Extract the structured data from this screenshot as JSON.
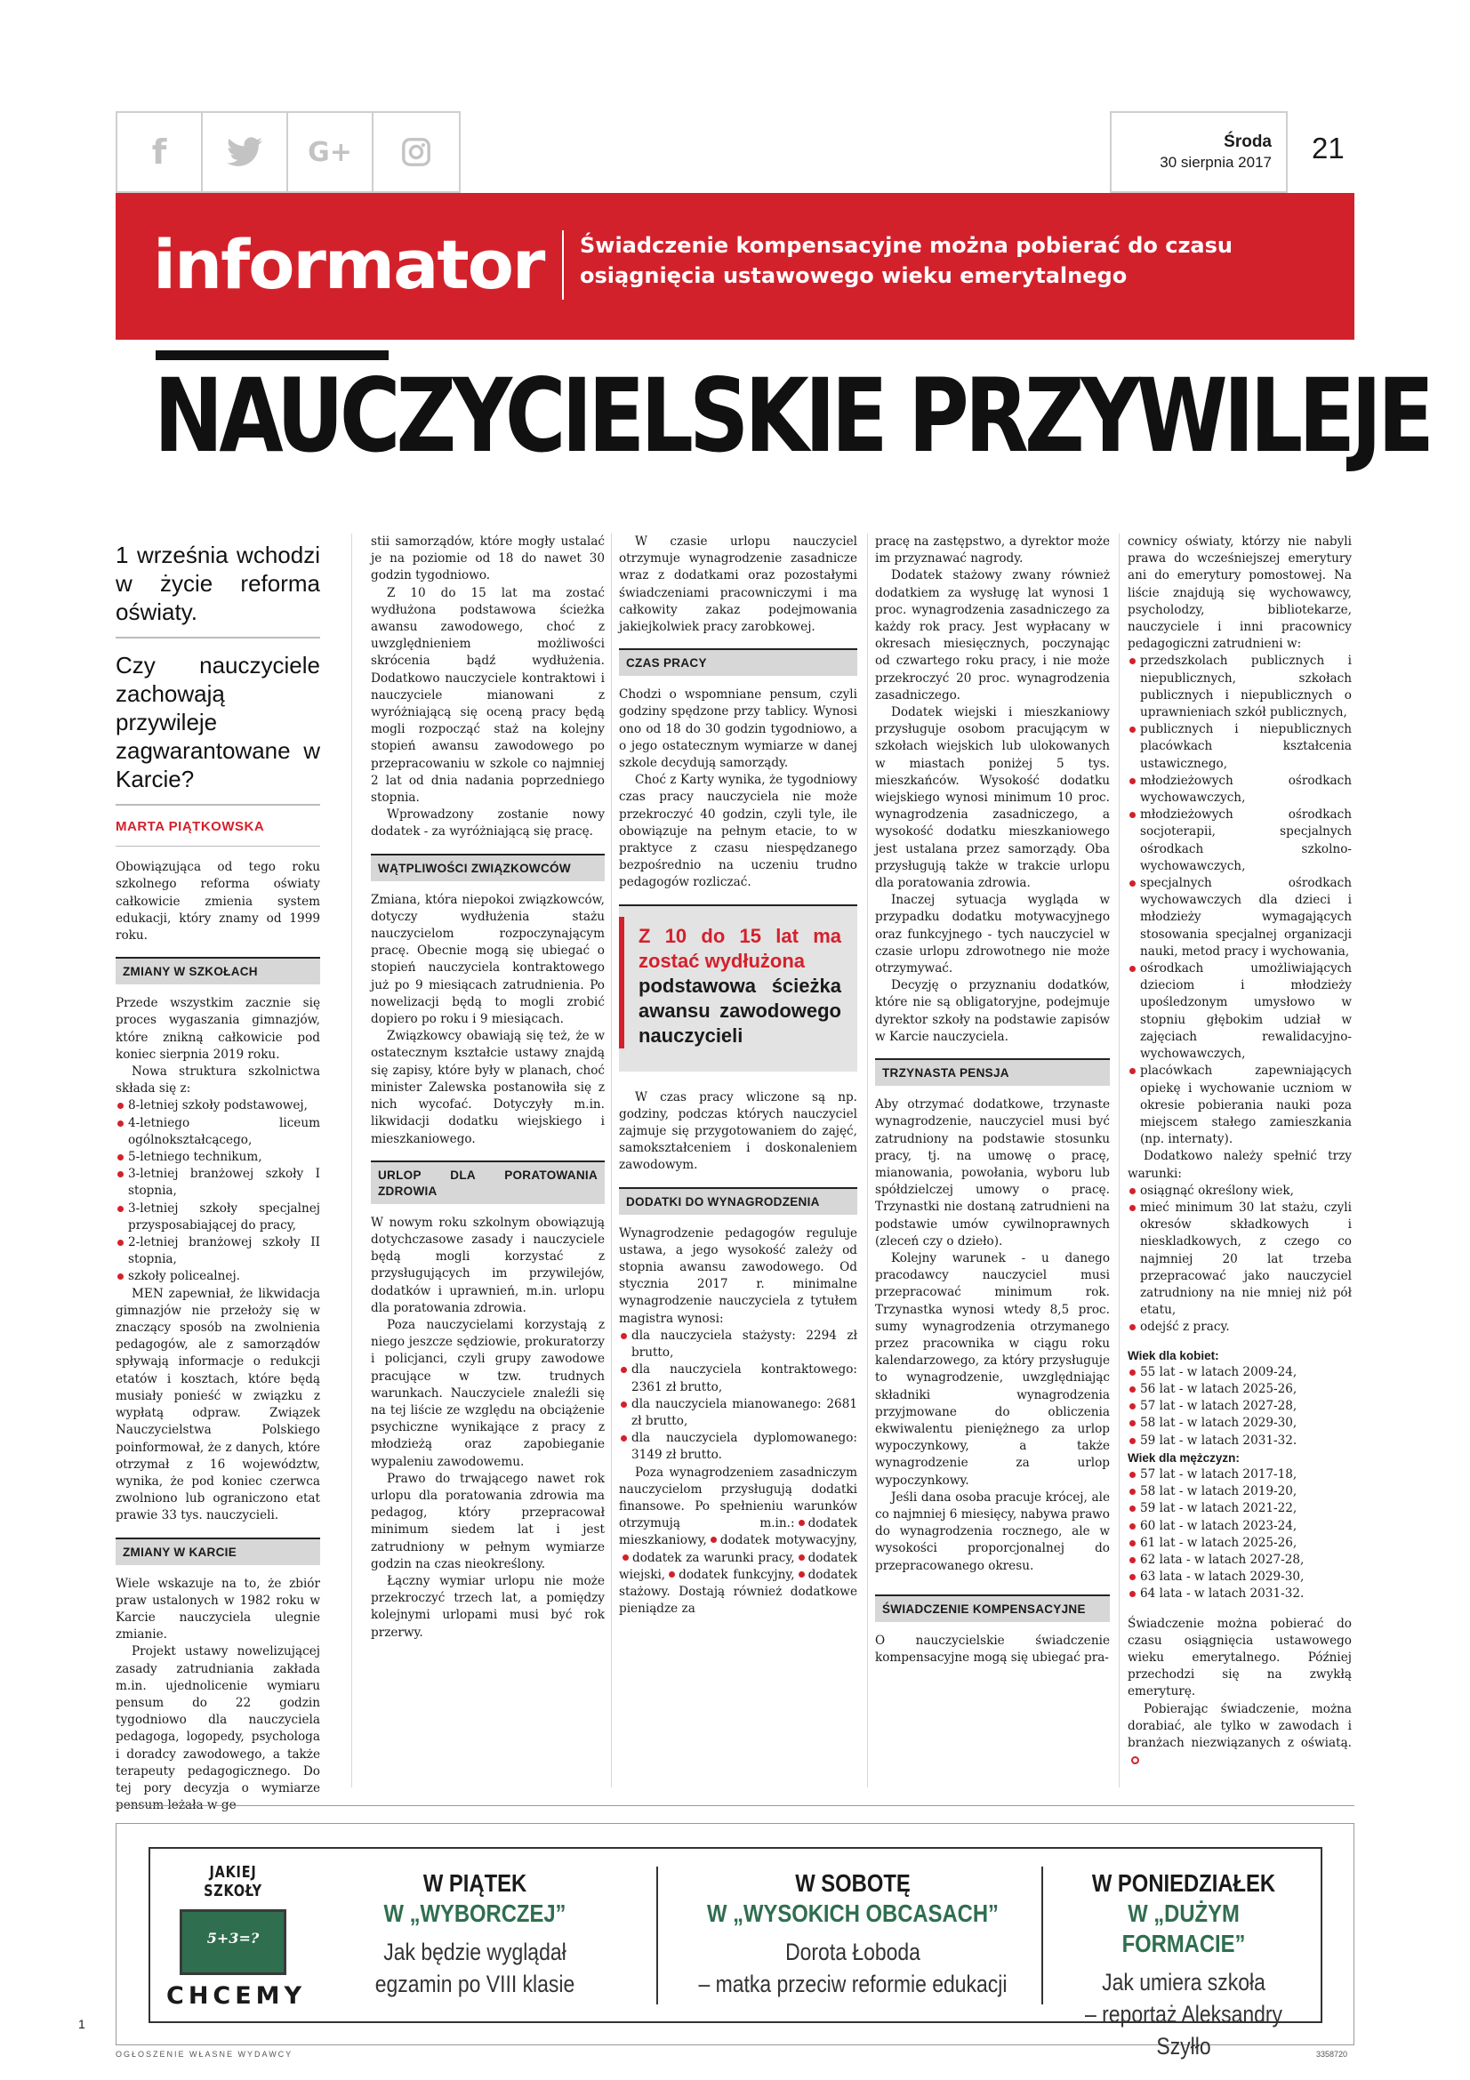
{
  "social": {
    "facebook": "f",
    "twitter": "🐦",
    "gplus": "G+",
    "instagram": "◎"
  },
  "header": {
    "day": "Środa",
    "date": "30 sierpnia 2017",
    "page": "21"
  },
  "banner": {
    "brand": "informator",
    "tagline": "Świadczenie kompensacyjne można pobierać do czasu osiągnięcia ustawowego wieku emerytalnego"
  },
  "headline": "NAUCZYCIELSKIE PRZYWILEJE",
  "lead": {
    "q1": "1 września wchodzi w życie reforma oświaty.",
    "q2": "Czy nauczyciele zachowają przywileje zagwarantowane w Karcie?",
    "author": "MARTA PIĄTKOWSKA"
  },
  "col1": {
    "intro": "Obowiązująca od tego roku szkolnego reforma oświaty całkowicie zmienia system edukacji, który znamy od 1999 roku.",
    "s1": "ZMIANY W SZKOŁACH",
    "p1": "Przede wszystkim zacznie się proces wygaszania gimnazjów, które znikną całkowicie pod koniec sierpnia 2019 roku.",
    "p2": "Nowa struktura szkolnictwa składa się z:",
    "list": [
      "8-letniej szkoły podstawowej,",
      "4-letniego liceum ogólnokształcącego,",
      "5-letniego technikum,",
      "3-letniej branżowej szkoły I stopnia,",
      "3-letniej szkoły specjalnej przysposabiającej do pracy,",
      "2-letniej branżowej szkoły II stopnia,",
      "szkoły policealnej."
    ],
    "p3": "MEN zapewniał, że likwidacja gimnazjów nie przełoży się w znaczący sposób na zwolnienia pedagogów, ale z samorządów spływają informacje o redukcji etatów i kosztach, które będą musiały ponieść w związku z wypłatą odpraw. Związek Nauczycielstwa Polskiego poinformował, że z danych, które otrzymał z 16 województw, wynika, że pod koniec czerwca zwolniono lub ograniczono etat prawie 33 tys. nauczycieli.",
    "s2": "ZMIANY W KARCIE",
    "p4": "Wiele wskazuje na to, że zbiór praw ustalonych w 1982 roku w Karcie nauczyciela ulegnie zmianie.",
    "p5": "Projekt ustawy nowelizującej zasady zatrudniania zakłada m.in. ujednolicenie wymiaru pensum do 22 godzin tygodniowo dla nauczyciela pedagoga, logopedy, psychologa i doradcy zawodowego, a także terapeuty pedagogicznego. Do tej pory decyzja o wymiarze pensum leżała w ge-"
  },
  "col2": {
    "p1": "stii samorządów, które mogły ustalać je na poziomie od 18 do nawet 30 godzin tygodniowo.",
    "p2": "Z 10 do 15 lat ma zostać wydłużona podstawowa ścieżka awansu zawodowego, choć z uwzględnieniem możliwości skrócenia bądź wydłużenia. Dodatkowo nauczyciele kontraktowi i nauczyciele mianowani z wyróżniającą się oceną pracy będą mogli rozpocząć staż na kolejny stopień awansu zawodowego po przepracowaniu w szkole co najmniej 2 lat od dnia nadania poprzedniego stopnia.",
    "p3": "Wprowadzony zostanie nowy dodatek - za wyróżniającą się pracę.",
    "s1": "WĄTPLIWOŚCI ZWIĄZKOWCÓW",
    "p4": "Zmiana, która niepokoi związkowców, dotyczy wydłużenia stażu nauczycielom rozpoczynającym pracę. Obecnie mogą się ubiegać o stopień nauczyciela kontraktowego już po 9 miesiącach zatrudnienia. Po nowelizacji będą to mogli zrobić dopiero po roku i 9 miesiącach.",
    "p5": "Związkowcy obawiają się też, że w ostatecznym kształcie ustawy znajdą się zapisy, które były w planach, choć minister Zalewska postanowiła się z nich wycofać. Dotyczyły m.in. likwidacji dodatku wiejskiego i mieszkaniowego.",
    "s2": "URLOP DLA PORATOWANIA ZDROWIA",
    "p6": "W nowym roku szkolnym obowiązują dotychczasowe zasady i nauczyciele będą mogli korzystać z przysługujących im przywilejów, dodatków i uprawnień, m.in. urlopu dla poratowania zdrowia.",
    "p7": "Poza nauczycielami korzystają z niego jeszcze sędziowie, prokuratorzy i policjanci, czyli grupy zawodowe pracujące w tzw. trudnych warunkach. Nauczyciele znaleźli się na tej liście ze względu na obciążenie psychiczne wynikające z pracy z młodzieżą oraz zapobieganie wypaleniu zawodowemu.",
    "p8": "Prawo do trwającego nawet rok urlopu dla poratowania zdrowia ma pedagog, który przepracował minimum siedem lat i jest zatrudniony w pełnym wymiarze godzin na czas nieokreślony.",
    "p9": "Łączny wymiar urlopu nie może przekroczyć trzech lat, a pomiędzy kolejnymi urlopami musi być rok przerwy."
  },
  "col3": {
    "p1": "W czasie urlopu nauczyciel otrzymuje wynagrodzenie zasadnicze wraz z dodatkami oraz pozostałymi świadczeniami pracowniczymi i ma całkowity zakaz podejmowania jakiejkolwiek pracy zarobkowej.",
    "s1": "CZAS PRACY",
    "p2": "Chodzi o wspomniane pensum, czyli godziny spędzone przy tablicy. Wynosi ono od 18 do 30 godzin tygodniowo, a o jego ostatecznym wymiarze w danej szkole decydują samorządy.",
    "p3": "Choć z Karty wynika, że tygodniowy czas pracy nauczyciela nie może przekroczyć 40 godzin, czyli tyle, ile obowiązuje na pełnym etacie, to w praktyce z czasu niespędzanego bezpośrednio na uczeniu trudno pedagogów rozliczać.",
    "pull_red": "Z 10 do 15 lat ma zostać wydłużona",
    "pull_black": "podstawowa ścieżka awansu zawodowego nauczycieli",
    "p4": "W czas pracy wliczone są np. godziny, podczas których nauczyciel zajmuje się przygotowaniem do zajęć, samokształceniem i doskonaleniem zawodowym.",
    "s2": "DODATKI DO WYNAGRODZENIA",
    "p5": "Wynagrodzenie pedagogów reguluje ustawa, a jego wysokość zależy od stopnia awansu zawodowego. Od stycznia 2017 r. minimalne wynagrodzenie nauczyciela z tytułem magistra wynosi:",
    "list": [
      "dla nauczyciela stażysty: 2294 zł brutto,",
      "dla nauczyciela kontraktowego: 2361 zł brutto,",
      "dla nauczyciela mianowanego: 2681 zł brutto,",
      "dla nauczyciela dyplomowanego: 3149 zł brutto."
    ],
    "p6a": "Poza wynagrodzeniem zasadniczym nauczycielom przysługują dodatki finansowe. Po spełnieniu warunków otrzymują m.in.:",
    "d1": "dodatek mieszkaniowy,",
    "d2": "dodatek motywacyjny,",
    "d3": "dodatek za warunki pracy,",
    "d4": "dodatek wiejski,",
    "d5": "dodatek funkcyjny,",
    "d6": "dodatek stażowy.",
    "p6b": "Dostają również dodatkowe pieniądze za"
  },
  "col4": {
    "p1": "pracę na zastępstwo, a dyrektor może im przyznawać nagrody.",
    "p2": "Dodatek stażowy zwany również dodatkiem za wysługę lat wynosi 1 proc. wynagrodzenia zasadniczego za każdy rok pracy. Jest wypłacany w okresach miesięcznych, poczynając od czwartego roku pracy, i nie może przekroczyć 20 proc. wynagrodzenia zasadniczego.",
    "p3": "Dodatek wiejski i mieszkaniowy przysługuje osobom pracującym w szkołach wiejskich lub ulokowanych w miastach poniżej 5 tys. mieszkańców. Wysokość dodatku wiejskiego wynosi minimum 10 proc. wynagrodzenia zasadniczego, a wysokość dodatku mieszkaniowego jest ustalana przez samorządy. Oba przysługują także w trakcie urlopu dla poratowania zdrowia.",
    "p4": "Inaczej sytuacja wygląda w przypadku dodatku motywacyjnego oraz funkcyjnego - tych nauczyciel w czasie urlopu zdrowotnego nie może otrzymywać.",
    "p5": "Decyzję o przyznaniu dodatków, które nie są obligatoryjne, podejmuje dyrektor szkoły na podstawie zapisów w Karcie nauczyciela.",
    "s1": "TRZYNASTA PENSJA",
    "p6": "Aby otrzymać dodatkowe, trzynaste wynagrodzenie, nauczyciel musi być zatrudniony na podstawie stosunku pracy, tj. na umowę o pracę, mianowania, powołania, wyboru lub spółdzielczej umowy o pracę. Trzynastki nie dostaną zatrudnieni na podstawie umów cywilnoprawnych (zleceń czy o dzieło).",
    "p7": "Kolejny warunek - u danego pracodawcy nauczyciel musi przepracować minimum rok. Trzynastka wynosi wtedy 8,5 proc. sumy wynagrodzenia otrzymanego przez pracownika w ciągu roku kalendarzowego, za który przysługuje to wynagrodzenie, uwzględniając składniki wynagrodzenia przyjmowane do obliczenia ekwiwalentu pieniężnego za urlop wypoczynkowy, a także wynagrodzenie za urlop wypoczynkowy.",
    "p8": "Jeśli dana osoba pracuje krócej, ale co najmniej 6 miesięcy, nabywa prawo do wynagrodzenia rocznego, ale w wysokości proporcjonalnej do przepracowanego okresu.",
    "s2": "ŚWIADCZENIE KOMPENSACYJNE",
    "p9": "O nauczycielskie świadczenie kompensacyjne mogą się ubiegać pra-"
  },
  "col5": {
    "p1": "cownicy oświaty, którzy nie nabyli prawa do wcześniejszej emerytury ani do emerytury pomostowej. Na liście znajdują się wychowawcy, psycholodzy, bibliotekarze, nauczyciele i inni pracownicy pedagogiczni zatrudnieni w:",
    "list": [
      "przedszkolach publicznych i niepublicznych, szkołach publicznych i niepublicznych o uprawnieniach szkół publicznych,",
      "publicznych i niepublicznych placówkach kształcenia ustawicznego,",
      "młodzieżowych ośrodkach wychowawczych,",
      "młodzieżowych ośrodkach socjoterapii, specjalnych ośrodkach szkolno-wychowawczych,",
      "specjalnych ośrodkach wychowawczych dla dzieci i młodzieży wymagających stosowania specjalnej organizacji nauki, metod pracy i wychowania,",
      "ośrodkach umożliwiających dzieciom i młodzieży upośledzonym umysłowo w stopniu głębokim udział w zajęciach rewalidacyjno-wychowawczych,",
      "placówkach zapewniających opiekę i wychowanie uczniom w okresie pobierania nauki poza miejscem stałego zamieszkania (np. internaty)."
    ],
    "p2": "Dodatkowo należy spełnić trzy warunki:",
    "list2": [
      "osiągnąć określony wiek,",
      "mieć minimum 30 lat stażu, czyli okresów składkowych i nieskladkowych, z czego co najmniej 20 lat trzeba przepracować jako nauczyciel zatrudniony na nie mniej niż pół etatu,",
      "odejść z pracy."
    ],
    "women_h": "Wiek dla kobiet:",
    "women": [
      "55 lat - w latach 2009-24,",
      "56 lat - w latach 2025-26,",
      "57 lat - w latach 2027-28,",
      "58 lat - w latach 2029-30,",
      "59 lat - w latach 2031-32."
    ],
    "men_h": "Wiek dla mężczyzn:",
    "men": [
      "57 lat - w latach 2017-18,",
      "58 lat - w latach 2019-20,",
      "59 lat - w latach 2021-22,",
      "60 lat - w latach 2023-24,",
      "61 lat - w latach 2025-26,",
      "62 lata - w latach 2027-28,",
      "63 lata - w latach 2029-30,",
      "64 lata - w latach 2031-32."
    ],
    "p3": "Świadczenie można pobierać do czasu osiągnięcia ustawowego wieku emerytalnego. Później przechodzi się na zwykłą emeryturę.",
    "p4": "Pobierając świadczenie, można dorabiać, ale tylko w zawodach i branżach niezwiązanych z oświatą."
  },
  "ad": {
    "logo_top": "JAKIEJ SZKOŁY",
    "logo_board": "5+3=?",
    "logo_bottom": "CHCEMY",
    "cols": [
      {
        "h1": "W PIĄTEK",
        "h2": "W „WYBORCZEJ”",
        "d1": "Jak będzie wyglądał",
        "d2": "egzamin po VIII klasie"
      },
      {
        "h1": "W SOBOTĘ",
        "h2": "W „WYSOKICH OBCASACH”",
        "d1": "Dorota Łoboda",
        "d2": "– matka przeciw reformie edukacji"
      },
      {
        "h1": "W PONIEDZIAŁEK",
        "h2": "W „DUŻYM FORMACIE”",
        "d1": "Jak umiera szkoła",
        "d2": "– reportaż Aleksandry Szyłło"
      }
    ]
  },
  "footer": {
    "num": "1",
    "left": "OGŁOSZENIE WŁASNE WYDAWCY",
    "right": "3358720"
  }
}
